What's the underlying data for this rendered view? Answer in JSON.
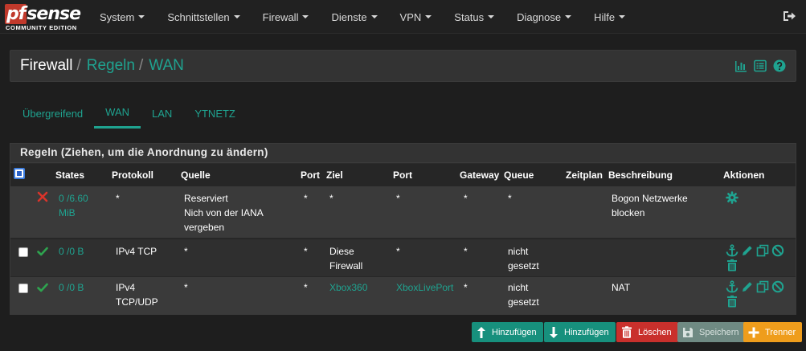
{
  "brand": {
    "logo_text": "pfsense",
    "logo_sub": "COMMUNITY EDITION"
  },
  "nav": {
    "items": [
      "System",
      "Schnittstellen",
      "Firewall",
      "Dienste",
      "VPN",
      "Status",
      "Diagnose",
      "Hilfe"
    ]
  },
  "breadcrumb": {
    "root": "Firewall",
    "sep": "/",
    "level2": "Regeln",
    "level3": "WAN"
  },
  "tabs": [
    "Übergreifend",
    "WAN",
    "LAN",
    "YTNETZ"
  ],
  "panel": {
    "title": "Regeln (Ziehen, um die Anordnung zu ändern)"
  },
  "table": {
    "headers": {
      "states": "States",
      "protocol": "Protokoll",
      "source": "Quelle",
      "src_port": "Port",
      "dest": "Ziel",
      "dst_port": "Port",
      "gateway": "Gateway",
      "queue": "Queue",
      "schedule": "Zeitplan",
      "description": "Beschreibung",
      "actions": "Aktionen"
    },
    "rows": [
      {
        "status": "block",
        "states_l1": "0 /6.60",
        "states_l2": "MiB",
        "protocol_l1": "*",
        "protocol_l2": "",
        "source_l1": "Reserviert",
        "source_l2": "Nich von der IANA",
        "source_l3": "vergeben",
        "src_port": "*",
        "dest_l1": "*",
        "dest_l2": "",
        "dst_port": "*",
        "gateway": "*",
        "queue_l1": "*",
        "queue_l2": "",
        "schedule": "",
        "description_l1": "Bogon Netzwerke",
        "description_l2": "blocken"
      },
      {
        "status": "pass",
        "states_l1": "0 /0 B",
        "states_l2": "",
        "protocol_l1": "IPv4 TCP",
        "protocol_l2": "",
        "source_l1": "*",
        "source_l2": "",
        "source_l3": "",
        "src_port": "*",
        "dest_l1": "Diese",
        "dest_l2": "Firewall",
        "dst_port": "*",
        "gateway": "*",
        "queue_l1": "nicht",
        "queue_l2": "gesetzt",
        "schedule": "",
        "description_l1": "",
        "description_l2": ""
      },
      {
        "status": "pass",
        "states_l1": "0 /0 B",
        "states_l2": "",
        "protocol_l1": "IPv4",
        "protocol_l2": "TCP/UDP",
        "source_l1": "*",
        "source_l2": "",
        "source_l3": "",
        "src_port": "*",
        "dest_l1": "Xbox360",
        "dest_l2": "",
        "dst_port": "XboxLivePort",
        "gateway": "*",
        "queue_l1": "nicht",
        "queue_l2": "gesetzt",
        "schedule": "",
        "description_l1": "NAT",
        "description_l2": ""
      }
    ]
  },
  "buttons": {
    "add_top": "Hinzufügen",
    "add_bottom": "Hinzufügen",
    "delete": "Löschen",
    "save": "Speichern",
    "separator": "Trenner"
  },
  "colors": {
    "accent": "#1fa390",
    "danger": "#c9302c",
    "warning": "#ef9d1c",
    "pass": "#2ea44f",
    "block": "#d9342b"
  }
}
